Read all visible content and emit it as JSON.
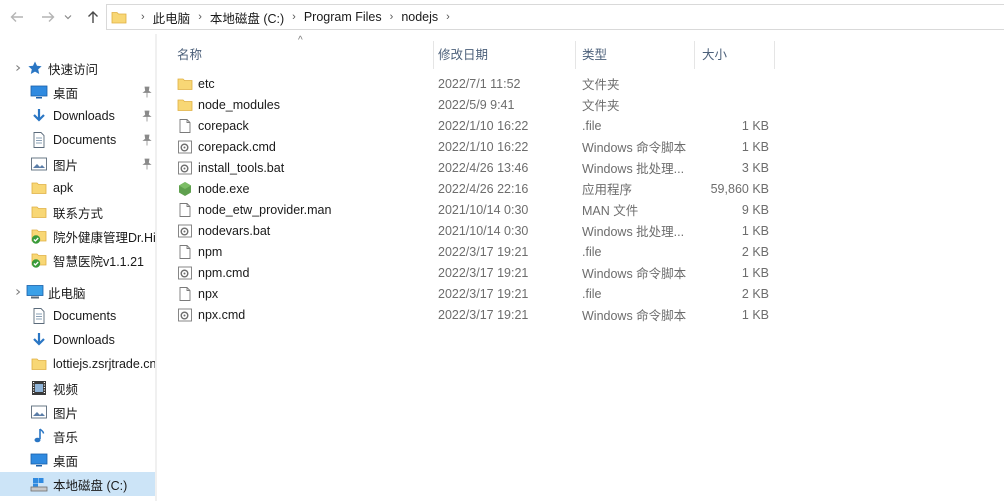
{
  "address": {
    "breadcrumbs": [
      "此电脑",
      "本地磁盘 (C:)",
      "Program Files",
      "nodejs"
    ]
  },
  "columns": {
    "name": "名称",
    "date": "修改日期",
    "type": "类型",
    "size": "大小"
  },
  "sidebar": {
    "quick_access": "快速访问",
    "quick_items": [
      {
        "label": "桌面",
        "icon": "desktop-icon",
        "pinned": true
      },
      {
        "label": "Downloads",
        "icon": "download-arrow-icon",
        "pinned": true
      },
      {
        "label": "Documents",
        "icon": "document-icon",
        "pinned": true
      },
      {
        "label": "图片",
        "icon": "pictures-icon",
        "pinned": true
      },
      {
        "label": "apk",
        "icon": "folder-icon",
        "pinned": false
      },
      {
        "label": "联系方式",
        "icon": "folder-icon",
        "pinned": false
      },
      {
        "label": "院外健康管理Dr.Hi",
        "icon": "folder-check-icon",
        "pinned": false
      },
      {
        "label": "智慧医院v1.1.21",
        "icon": "folder-check-icon",
        "pinned": false
      }
    ],
    "this_pc": "此电脑",
    "pc_items": [
      {
        "label": "Documents",
        "icon": "document-icon"
      },
      {
        "label": "Downloads",
        "icon": "download-arrow-icon"
      },
      {
        "label": "lottiejs.zsrjtrade.cn",
        "icon": "folder-icon"
      },
      {
        "label": "视频",
        "icon": "video-icon"
      },
      {
        "label": "图片",
        "icon": "pictures-icon"
      },
      {
        "label": "音乐",
        "icon": "music-icon"
      },
      {
        "label": "桌面",
        "icon": "desktop-icon"
      },
      {
        "label": "本地磁盘 (C:)",
        "icon": "drive-icon"
      }
    ]
  },
  "files": [
    {
      "name": "etc",
      "date": "2022/7/1 11:52",
      "type": "文件夹",
      "size": "",
      "icon": "folder-icon"
    },
    {
      "name": "node_modules",
      "date": "2022/5/9 9:41",
      "type": "文件夹",
      "size": "",
      "icon": "folder-icon"
    },
    {
      "name": "corepack",
      "date": "2022/1/10 16:22",
      "type": ".file",
      "size": "1 KB",
      "icon": "file-icon"
    },
    {
      "name": "corepack.cmd",
      "date": "2022/1/10 16:22",
      "type": "Windows 命令脚本",
      "size": "1 KB",
      "icon": "script-icon"
    },
    {
      "name": "install_tools.bat",
      "date": "2022/4/26 13:46",
      "type": "Windows 批处理...",
      "size": "3 KB",
      "icon": "script-icon"
    },
    {
      "name": "node.exe",
      "date": "2022/4/26 22:16",
      "type": "应用程序",
      "size": "59,860 KB",
      "icon": "node-app-icon"
    },
    {
      "name": "node_etw_provider.man",
      "date": "2021/10/14 0:30",
      "type": "MAN 文件",
      "size": "9 KB",
      "icon": "file-icon"
    },
    {
      "name": "nodevars.bat",
      "date": "2021/10/14 0:30",
      "type": "Windows 批处理...",
      "size": "1 KB",
      "icon": "script-icon"
    },
    {
      "name": "npm",
      "date": "2022/3/17 19:21",
      "type": ".file",
      "size": "2 KB",
      "icon": "file-icon"
    },
    {
      "name": "npm.cmd",
      "date": "2022/3/17 19:21",
      "type": "Windows 命令脚本",
      "size": "1 KB",
      "icon": "script-icon"
    },
    {
      "name": "npx",
      "date": "2022/3/17 19:21",
      "type": ".file",
      "size": "2 KB",
      "icon": "file-icon"
    },
    {
      "name": "npx.cmd",
      "date": "2022/3/17 19:21",
      "type": "Windows 命令脚本",
      "size": "1 KB",
      "icon": "script-icon"
    }
  ],
  "colors": {
    "folder": "#f8d775",
    "folder_dark": "#e0b043",
    "accent": "#0078d7",
    "selected": "#cce4f7",
    "header_text": "#4c607a"
  }
}
